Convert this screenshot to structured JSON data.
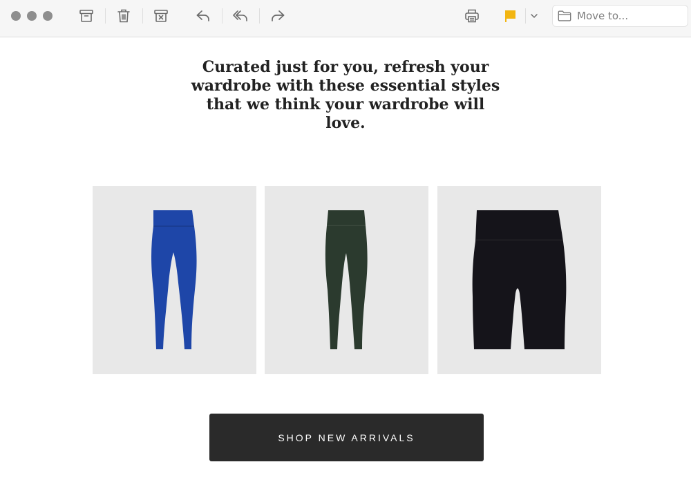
{
  "toolbar": {
    "traffic_lights": [
      "close",
      "minimize",
      "zoom"
    ],
    "buttons": [
      {
        "name": "archive",
        "icon": "archive-icon"
      },
      {
        "name": "delete",
        "icon": "trash-icon"
      },
      {
        "name": "junk",
        "icon": "junk-icon"
      },
      {
        "name": "reply",
        "icon": "reply-icon"
      },
      {
        "name": "reply-all",
        "icon": "reply-all-icon"
      },
      {
        "name": "forward",
        "icon": "forward-icon"
      },
      {
        "name": "print",
        "icon": "printer-icon"
      },
      {
        "name": "flag",
        "icon": "flag-icon"
      },
      {
        "name": "flag-menu",
        "icon": "chevron-down-icon"
      }
    ],
    "flag_color": "#f2b511",
    "move_to_label": "Move to..."
  },
  "email": {
    "headline": "Curated just for you, refresh your wardrobe with these essential styles that we think your wardrobe will love.",
    "products": [
      {
        "item": "leggings",
        "color": "#1e46a8"
      },
      {
        "item": "leggings",
        "color": "#2b3a2e"
      },
      {
        "item": "bike-shorts",
        "color": "#15141a"
      }
    ],
    "cta_label": "SHOP NEW ARRIVALS"
  }
}
